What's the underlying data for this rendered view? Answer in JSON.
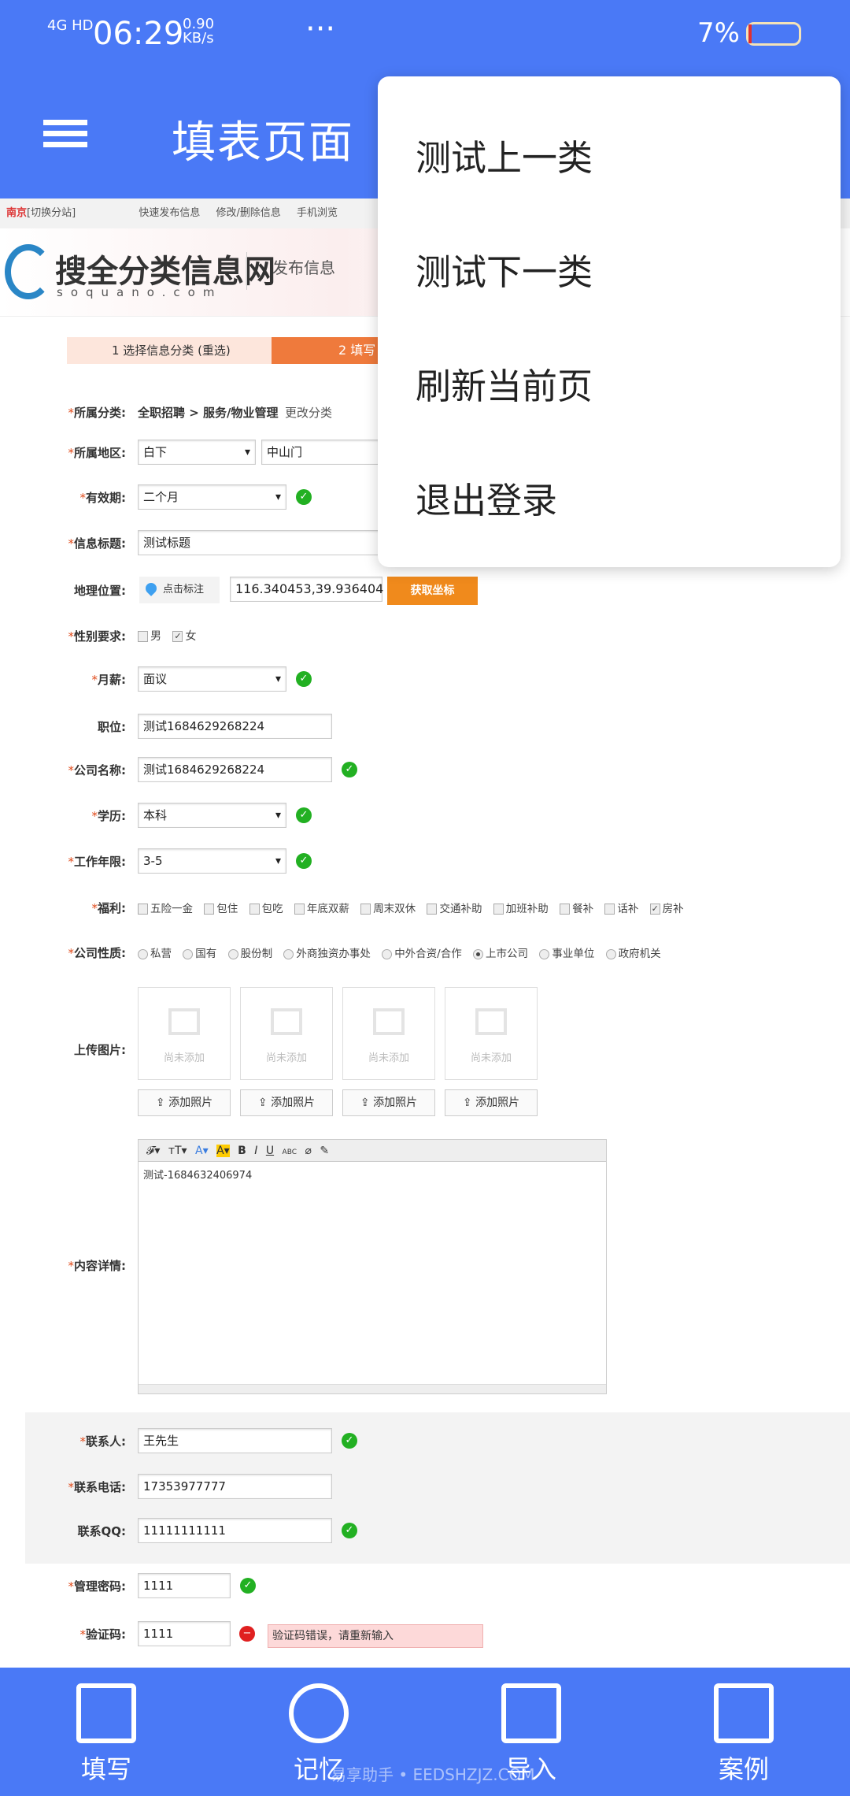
{
  "status": {
    "network": "4G HD",
    "time": "06:29",
    "speed": "0.90 KB/s",
    "more": "···",
    "battery": "7%",
    "battery_level": 0.07
  },
  "header": {
    "title": "填表页面"
  },
  "menu": {
    "items": [
      "测试上一类",
      "测试下一类",
      "刷新当前页",
      "退出登录"
    ]
  },
  "web": {
    "city": "南京",
    "switch": "[切换分站]",
    "links": [
      "快速发布信息",
      "修改/删除信息",
      "手机浏览"
    ],
    "logo": "搜全分类信息网",
    "logo_sub": "soquano.com",
    "section": "发布信息",
    "steps": [
      "1  选择信息分类 (重选)",
      "2  填写"
    ]
  },
  "form": {
    "category": {
      "label": "所属分类:",
      "value": "全职招聘 > 服务/物业管理",
      "change": "更改分类"
    },
    "region": {
      "label": "所属地区:",
      "v1": "白下",
      "v2": "中山门"
    },
    "validity": {
      "label": "有效期:",
      "value": "二个月"
    },
    "title": {
      "label": "信息标题:",
      "value": "测试标题"
    },
    "geo": {
      "label": "地理位置:",
      "mark": "点击标注",
      "value": "116.340453,39.936404",
      "button": "获取坐标"
    },
    "gender": {
      "label": "性别要求:",
      "options": [
        "男",
        "女"
      ],
      "checked": "女"
    },
    "salary": {
      "label": "月薪:",
      "value": "面议"
    },
    "position": {
      "label": "职位:",
      "value": "测试1684629268224"
    },
    "company": {
      "label": "公司名称:",
      "value": "测试1684629268224"
    },
    "education": {
      "label": "学历:",
      "value": "本科"
    },
    "years": {
      "label": "工作年限:",
      "value": "3-5"
    },
    "welfare": {
      "label": "福利:",
      "options": [
        "五险一金",
        "包住",
        "包吃",
        "年底双薪",
        "周末双休",
        "交通补助",
        "加班补助",
        "餐补",
        "话补",
        "房补"
      ],
      "checked": "房补"
    },
    "nature": {
      "label": "公司性质:",
      "options": [
        "私营",
        "国有",
        "股份制",
        "外商独资办事处",
        "中外合资/合作",
        "上市公司",
        "事业单位",
        "政府机关"
      ],
      "selected": "上市公司"
    },
    "upload": {
      "label": "上传图片:",
      "placeholder": "尚未添加",
      "button": "添加照片"
    },
    "content": {
      "label": "内容详情:",
      "value": "测试-1684632406974"
    },
    "contact": {
      "label": "联系人:",
      "value": "王先生"
    },
    "phone": {
      "label": "联系电话:",
      "value": "17353977777"
    },
    "qq": {
      "label": "联系QQ:",
      "value": "11111111111"
    },
    "password": {
      "label": "管理密码:",
      "value": "1111"
    },
    "captcha": {
      "label": "验证码:",
      "value": "1111",
      "error": "验证码错误，请重新输入"
    }
  },
  "nav": {
    "items": [
      "填写",
      "记忆",
      "导入",
      "案例"
    ],
    "watermark": "易享助手 • EEDSHZJZ.COM"
  },
  "colors": {
    "brand": "#4a79f6",
    "accent": "#f08a1c",
    "ok": "#22b022",
    "error": "#e02020"
  }
}
